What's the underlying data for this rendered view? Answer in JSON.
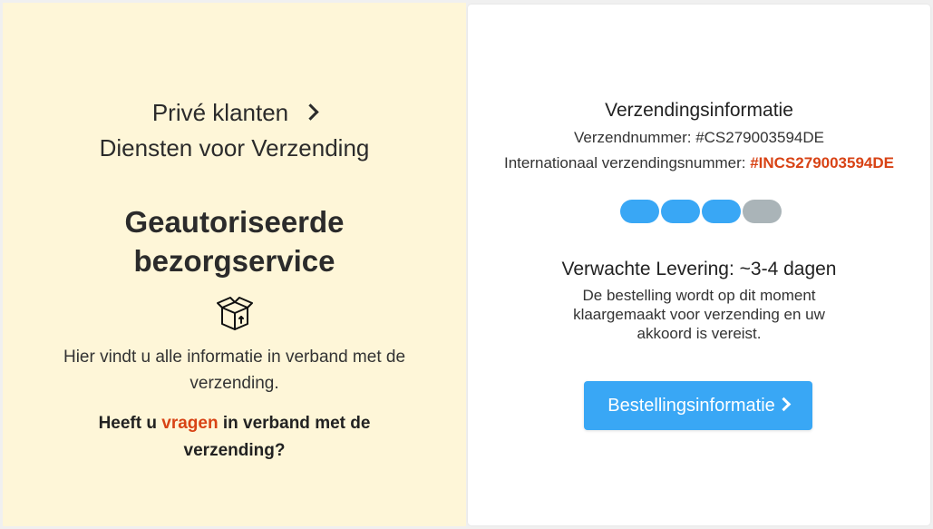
{
  "breadcrumb": {
    "item1": "Privé klanten",
    "item2": "Diensten voor Verzending"
  },
  "hero": {
    "title_line1": "Geautoriseerde",
    "title_line2": "bezorgservice",
    "icon": "package-box-icon"
  },
  "info": {
    "text": "Hier vindt u alle informatie in verband met de verzending."
  },
  "question": {
    "prefix": "Heeft u ",
    "link": "vragen",
    "suffix": " in verband met de verzending?"
  },
  "shipping": {
    "title": "Verzendingsinformatie",
    "number_label": "Verzendnummer:",
    "number_value": "#CS279003594DE",
    "intl_label": "Internationaal verzendingsnummer:",
    "intl_value": "#INCS279003594DE"
  },
  "progress": {
    "completed_steps": 3,
    "total_steps": 4,
    "active_color": "#39a7f5",
    "inactive_color": "#aab4b8"
  },
  "delivery": {
    "title": "Verwachte Levering: ~3-4 dagen",
    "description": "De bestelling wordt op dit moment klaargemaakt voor verzending en uw akkoord is vereist."
  },
  "order_button": {
    "label": "Bestellingsinformatie"
  },
  "colors": {
    "left_bg": "#fef6d8",
    "accent": "#d84315",
    "button": "#39a7f5"
  }
}
